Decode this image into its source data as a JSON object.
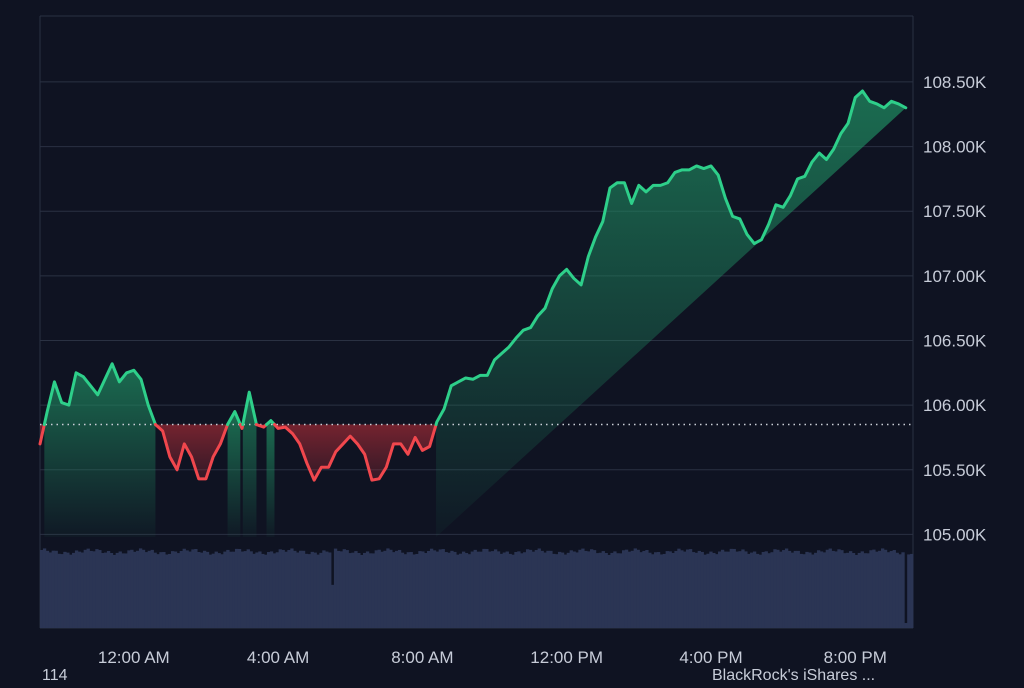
{
  "colors": {
    "background": "#0f1322",
    "grid": "#2a3142",
    "axis_text": "#c7ccd8",
    "up_line": "#2ecf8a",
    "down_line": "#f0474d",
    "baseline_dots": "#c9cdd6",
    "volume_bars": "#2b3554"
  },
  "chart_data": {
    "type": "line",
    "xlabel": "",
    "ylabel": "",
    "x_ticks": [
      "12:00 AM",
      "4:00 AM",
      "8:00 AM",
      "12:00 PM",
      "4:00 PM",
      "8:00 PM"
    ],
    "x_tick_hours": [
      0,
      4,
      8,
      12,
      16,
      20
    ],
    "y_ticks": [
      "105.00K",
      "105.50K",
      "106.00K",
      "106.50K",
      "107.00K",
      "107.50K",
      "108.00K",
      "108.50K"
    ],
    "y_tick_values": [
      105000,
      105500,
      106000,
      106500,
      107000,
      107500,
      108000,
      108500
    ],
    "xlim_hours": [
      -2.6,
      21.6
    ],
    "ylim": [
      104980,
      109010
    ],
    "baseline": 105850,
    "grid": true,
    "series": [
      {
        "x_hours": [
          -2.6,
          -2.4,
          -2.2,
          -2.0,
          -1.8,
          -1.6,
          -1.4,
          -1.2,
          -1.0,
          -0.8,
          -0.6,
          -0.4,
          -0.2,
          0.0,
          0.2,
          0.4,
          0.6,
          0.8,
          1.0,
          1.2,
          1.4,
          1.6,
          1.8,
          2.0,
          2.2,
          2.4,
          2.6,
          2.8,
          3.0,
          3.2,
          3.4,
          3.6,
          3.8,
          4.0,
          4.2,
          4.4,
          4.6,
          4.8,
          5.0,
          5.2,
          5.4,
          5.6,
          5.8,
          6.0,
          6.2,
          6.4,
          6.6,
          6.8,
          7.0,
          7.2,
          7.4,
          7.6,
          7.8,
          8.0,
          8.2,
          8.4,
          8.6,
          8.8,
          9.0,
          9.2,
          9.4,
          9.6,
          9.8,
          10.0,
          10.2,
          10.4,
          10.6,
          10.8,
          11.0,
          11.2,
          11.4,
          11.6,
          11.8,
          12.0,
          12.2,
          12.4,
          12.6,
          12.8,
          13.0,
          13.2,
          13.4,
          13.6,
          13.8,
          14.0,
          14.2,
          14.4,
          14.6,
          14.8,
          15.0,
          15.2,
          15.4,
          15.6,
          15.8,
          16.0,
          16.2,
          16.4,
          16.6,
          16.8,
          17.0,
          17.2,
          17.4,
          17.6,
          17.8,
          18.0,
          18.2,
          18.4,
          18.6,
          18.8,
          19.0,
          19.2,
          19.4,
          19.6,
          19.8,
          20.0,
          20.2,
          20.4,
          20.6,
          20.8,
          21.0,
          21.2,
          21.4,
          21.6
        ],
        "values": [
          105700,
          105950,
          106180,
          106020,
          106000,
          106250,
          106220,
          106150,
          106080,
          106200,
          106320,
          106180,
          106250,
          106270,
          106200,
          106000,
          105850,
          105800,
          105600,
          105500,
          105700,
          105600,
          105430,
          105430,
          105600,
          105700,
          105850,
          105950,
          105820,
          106100,
          105850,
          105830,
          105880,
          105820,
          105830,
          105780,
          105700,
          105550,
          105420,
          105520,
          105520,
          105640,
          105700,
          105760,
          105700,
          105620,
          105420,
          105430,
          105520,
          105700,
          105700,
          105620,
          105750,
          105650,
          105680,
          105870,
          105970,
          106150,
          106180,
          106210,
          106200,
          106230,
          106230,
          106350,
          106400,
          106450,
          106520,
          106580,
          106600,
          106690,
          106750,
          106900,
          107000,
          107050,
          106980,
          106930,
          107150,
          107300,
          107420,
          107680,
          107720,
          107720,
          107560,
          107700,
          107650,
          107700,
          107700,
          107720,
          107800,
          107820,
          107820,
          107850,
          107830,
          107850,
          107780,
          107600,
          107460,
          107440,
          107320,
          107250,
          107280,
          107400,
          107550,
          107530,
          107620,
          107750,
          107770,
          107880,
          107950,
          107900,
          107980,
          108100,
          108180,
          108380,
          108430,
          108350,
          108330,
          108300,
          108350,
          108330,
          108300
        ]
      }
    ],
    "volume": {
      "bar_count": 300,
      "level": 0.92,
      "level_range": 0.04,
      "dips": [
        {
          "index": 100,
          "level": 0.52
        },
        {
          "index": 297,
          "level": 0.06
        }
      ]
    }
  },
  "footer": {
    "left_text": "114",
    "right_text": "BlackRock's iShares ..."
  }
}
